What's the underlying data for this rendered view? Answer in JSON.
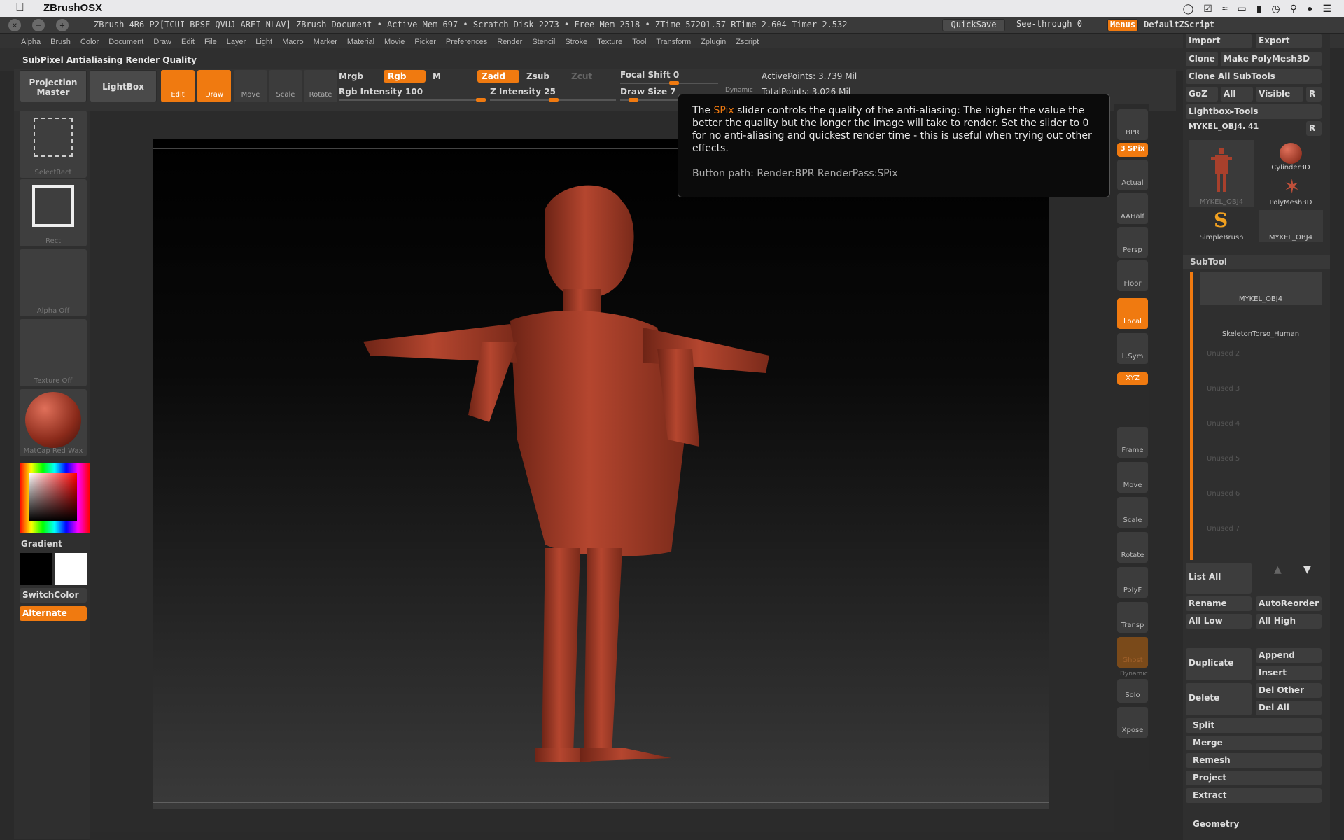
{
  "macbar": {
    "app": "ZBrushOSX"
  },
  "titlebar": {
    "title": "ZBrush 4R6 P2[TCUI-BPSF-QVUJ-AREI-NLAV]   ZBrush Document   • Active Mem 697 • Scratch Disk 2273 • Free Mem 2518 • ZTime 57201.57 RTime 2.604 Timer 2.532",
    "quicksave": "QuickSave",
    "see_through": "See-through  0",
    "menus": "Menus",
    "default_zscript": "DefaultZScript"
  },
  "menus": [
    "Alpha",
    "Brush",
    "Color",
    "Document",
    "Draw",
    "Edit",
    "File",
    "Layer",
    "Light",
    "Macro",
    "Marker",
    "Material",
    "Movie",
    "Picker",
    "Preferences",
    "Render",
    "Stencil",
    "Stroke",
    "Texture",
    "Tool",
    "Transform",
    "Zplugin",
    "Zscript"
  ],
  "infoline": "SubPixel Antialiasing Render Quality",
  "toolbar": {
    "projection_master": "Projection Master",
    "lightbox": "LightBox",
    "edit": "Edit",
    "draw": "Draw",
    "move": "Move",
    "scale": "Scale",
    "rotate": "Rotate",
    "mrgb": "Mrgb",
    "rgb": "Rgb",
    "m": "M",
    "zadd": "Zadd",
    "zsub": "Zsub",
    "zcut": "Zcut",
    "rgb_intensity": "Rgb Intensity 100",
    "z_intensity": "Z Intensity 25",
    "focal_shift": "Focal Shift 0",
    "draw_size": "Draw Size 7",
    "dynamic": "Dynamic",
    "active_points": "ActivePoints: 3.739 Mil",
    "total_points": "TotalPoints: 3.026 Mil"
  },
  "left": {
    "select_rect": "SelectRect",
    "rect": "Rect",
    "alpha": "Alpha Off",
    "texture": "Texture Off",
    "matcap": "MatCap Red Wax",
    "gradient": "Gradient",
    "switch_color": "SwitchColor",
    "alternate": "Alternate"
  },
  "tooltip": {
    "pre": "The ",
    "keyword": "SPix",
    "text": " slider controls the quality of the anti-aliasing: The higher the value the better the quality but the longer the image will take to render. Set the slider to 0 for no anti-aliasing and quickest render time - this is useful when trying out other effects.",
    "path": "Button path: Render:BPR RenderPass:SPix"
  },
  "rtools": {
    "bpr": "BPR",
    "spix": "3 SPix",
    "actual": "Actual",
    "aahalf": "AAHalf",
    "persp": "Persp",
    "floor": "Floor",
    "local": "Local",
    "lsym": "L.Sym",
    "xyz": "XYZ",
    "frame": "Frame",
    "move": "Move",
    "scale": "Scale",
    "rotate": "Rotate",
    "polyf": "PolyF",
    "transp": "Transp",
    "ghost": "Ghost",
    "dynamic": "Dynamic",
    "solo": "Solo",
    "xpose": "Xpose"
  },
  "rpanel": {
    "import": "Import",
    "export": "Export",
    "clone": "Clone",
    "make_polymesh": "Make PolyMesh3D",
    "clone_all": "Clone All SubTools",
    "goz": "GoZ",
    "all": "All",
    "visible": "Visible",
    "r": "R",
    "lightbox_tools": "Lightbox▸Tools",
    "tool_slider": "MYKEL_OBJ4. 41",
    "thumbs": [
      "MYKEL_OBJ4",
      "Cylinder3D",
      "PolyMesh3D",
      "SimpleBrush",
      "MYKEL_OBJ4"
    ],
    "subtool_header": "SubTool",
    "subtools": [
      "MYKEL_OBJ4",
      "SkeletonTorso_Human",
      "Unused 2",
      "Unused 3",
      "Unused 4",
      "Unused 5",
      "Unused 6",
      "Unused 7"
    ],
    "list_all": "List All",
    "rename": "Rename",
    "autoreorder": "AutoReorder",
    "all_low": "All Low",
    "all_high": "All High",
    "duplicate": "Duplicate",
    "append": "Append",
    "insert": "Insert",
    "delete": "Delete",
    "del_other": "Del Other",
    "del_all": "Del All",
    "split": "Split",
    "merge": "Merge",
    "remesh": "Remesh",
    "project": "Project",
    "extract": "Extract",
    "geometry": "Geometry"
  },
  "colors": {
    "accent": "#f07a10",
    "model": "#a8402c"
  }
}
